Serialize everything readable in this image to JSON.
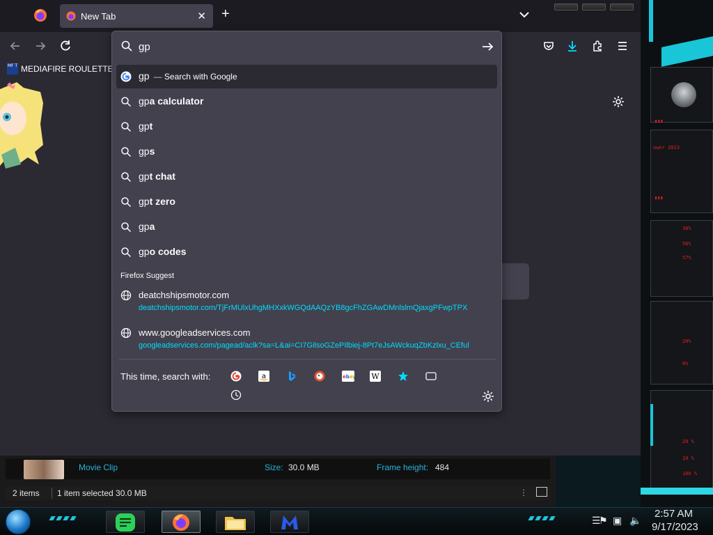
{
  "browser": {
    "tab": {
      "title": "New Tab"
    },
    "bookmarks": [
      {
        "label": "MEDIAFIRE ROULETTER",
        "icon_text": "MF T"
      }
    ]
  },
  "urlbar": {
    "value": "gp",
    "results": [
      {
        "typed": "gp",
        "completion": "",
        "action": "Search with Google",
        "icon": "google-icon"
      },
      {
        "typed": "gp",
        "completion": "a calculator",
        "icon": "search-icon"
      },
      {
        "typed": "gp",
        "completion": "t",
        "icon": "search-icon"
      },
      {
        "typed": "gp",
        "completion": "s",
        "icon": "search-icon"
      },
      {
        "typed": "gp",
        "completion": "t chat",
        "icon": "search-icon"
      },
      {
        "typed": "gp",
        "completion": "t zero",
        "icon": "search-icon"
      },
      {
        "typed": "gp",
        "completion": "a",
        "icon": "search-icon"
      },
      {
        "typed": "gp",
        "completion": "o codes",
        "icon": "search-icon"
      }
    ],
    "suggest_heading": "Firefox Suggest",
    "suggestions": [
      {
        "title": "deatchshipsmotor.com",
        "url": "deatchshipsmotor.com/TjFrMUlxUhgMHXxkWGQdAAQzYB8gcFhZGAwDMnlslmQjaxgPFwpTPX"
      },
      {
        "title": "www.googleadservices.com",
        "url": "googleadservices.com/pagead/aclk?sa=L&ai=CI7GilsoGZePIlbiej-8Pt7eJsAWckuqZbKzlxu_CEful"
      }
    ],
    "one_off_label": "This time, search with:",
    "one_off_engines": [
      "google-icon",
      "amazon-icon",
      "bing-icon",
      "duckduckgo-icon",
      "ebay-icon",
      "wikipedia-icon",
      "bookmarks-star-icon",
      "tabs-icon",
      "history-icon"
    ]
  },
  "explorer": {
    "file_type": "Movie Clip",
    "size_label": "Size:",
    "size_value": "30.0 MB",
    "frame_label": "Frame height:",
    "frame_value": "484",
    "status_items": "2 items",
    "status_selected": "1 item selected  30.0 MB"
  },
  "taskbar": {
    "time": "2:57 AM",
    "date": "9/17/2023"
  },
  "colors": {
    "accent_link": "#00ddff",
    "panel_bg": "#42414d",
    "browser_bg": "#2b2a33",
    "desktop_cyan": "#19c6d8",
    "desktop_red": "#e0201f"
  }
}
